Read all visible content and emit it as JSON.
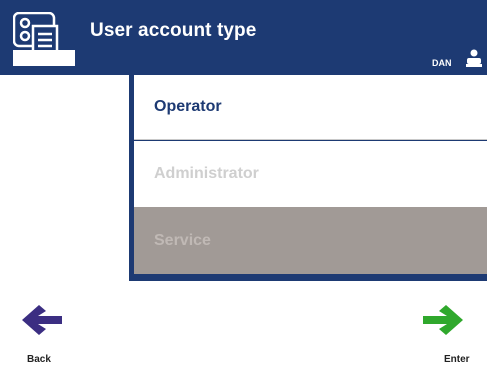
{
  "header": {
    "title": "User account type",
    "icon": "user-accounts-icon",
    "user_name": "DAN",
    "user_icon": "person-icon"
  },
  "options": [
    {
      "label": "Operator",
      "state": "enabled"
    },
    {
      "label": "Administrator",
      "state": "disabled"
    },
    {
      "label": "Service",
      "state": "disabled-highlighted"
    }
  ],
  "nav": {
    "back_label": "Back",
    "back_icon": "arrow-left-icon",
    "enter_label": "Enter",
    "enter_icon": "arrow-right-icon"
  },
  "colors": {
    "header_bg": "#1d3a73",
    "back_arrow": "#3b2e82",
    "enter_arrow": "#2fa82c",
    "service_bg": "#a19a96"
  }
}
